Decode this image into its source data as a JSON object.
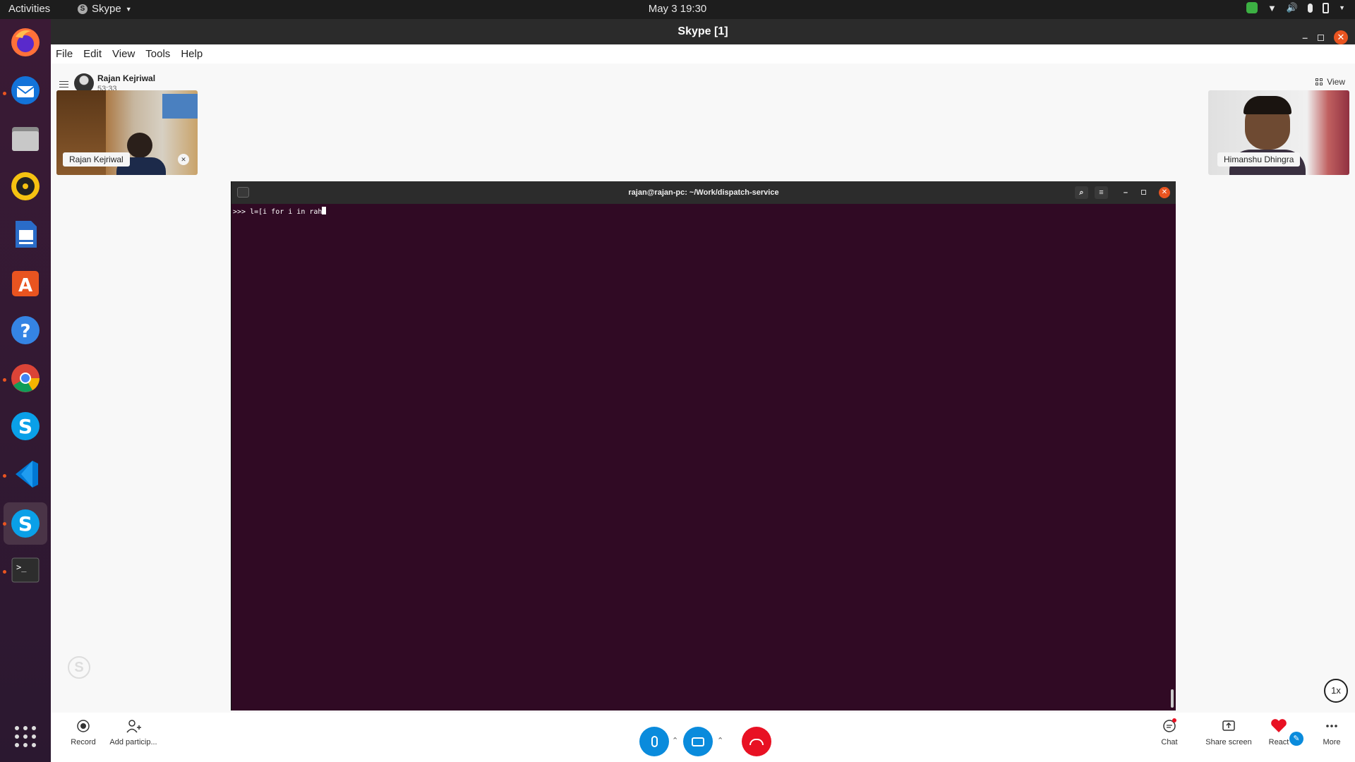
{
  "topbar": {
    "activities": "Activities",
    "app_name": "Skype",
    "clock": "May 3  19:30"
  },
  "window": {
    "title": "Skype [1]"
  },
  "menu": [
    "File",
    "Edit",
    "View",
    "Tools",
    "Help"
  ],
  "call": {
    "caller_name": "Rajan Kejriwal",
    "duration": "53:33",
    "view_label": "View",
    "participants": [
      {
        "name": "Rajan Kejriwal"
      },
      {
        "name": "Himanshu Dhingra"
      }
    ],
    "speed": "1x"
  },
  "terminal": {
    "title": "rajan@rajan-pc: ~/Work/dispatch-service",
    "prompt_line": ">>> l=[i for i in rah"
  },
  "controls": {
    "record": "Record",
    "add_participant": "Add particip...",
    "chat": "Chat",
    "share_screen": "Share screen",
    "react": "React",
    "more": "More"
  },
  "colors": {
    "accent": "#0078d4",
    "end_call": "#e81123",
    "terminal_bg": "#300a24",
    "ubuntu_orange": "#e95420"
  }
}
